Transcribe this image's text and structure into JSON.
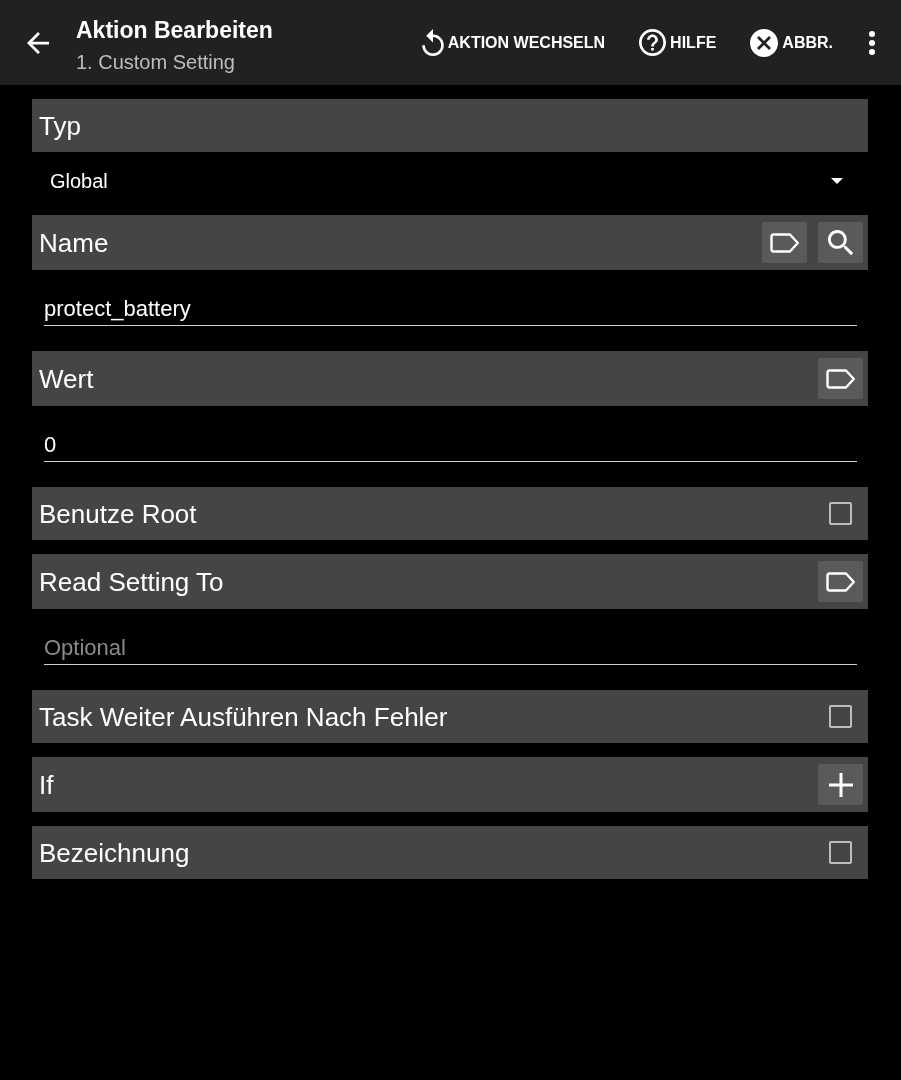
{
  "toolbar": {
    "title": "Aktion Bearbeiten",
    "subtitle": "1. Custom Setting",
    "actions": [
      {
        "kind": "switch",
        "label": "AKTION WECHSELN"
      },
      {
        "kind": "help",
        "label": "HILFE"
      },
      {
        "kind": "cancel",
        "label": "ABBR."
      }
    ]
  },
  "items": [
    {
      "kind": "header",
      "label": "Typ"
    },
    {
      "kind": "dropdown",
      "value": "Global"
    },
    {
      "kind": "header",
      "label": "Name",
      "actions": [
        {
          "kind": "tag"
        },
        {
          "kind": "search"
        }
      ]
    },
    {
      "kind": "input",
      "value": "protect_battery"
    },
    {
      "kind": "header",
      "label": "Wert",
      "actions": [
        {
          "kind": "tag"
        }
      ]
    },
    {
      "kind": "input",
      "value": "0"
    },
    {
      "kind": "checkbox",
      "label": "Benutze Root",
      "checked": false
    },
    {
      "kind": "header",
      "label": "Read Setting To",
      "actions": [
        {
          "kind": "tag"
        }
      ]
    },
    {
      "kind": "input",
      "placeholder": "Optional"
    },
    {
      "kind": "checkbox",
      "label": "Task Weiter Ausführen Nach Fehler",
      "checked": false
    },
    {
      "kind": "header",
      "label": "If",
      "actions": [
        {
          "kind": "add"
        }
      ]
    },
    {
      "kind": "checkbox",
      "label": "Bezeichnung",
      "checked": false
    }
  ]
}
